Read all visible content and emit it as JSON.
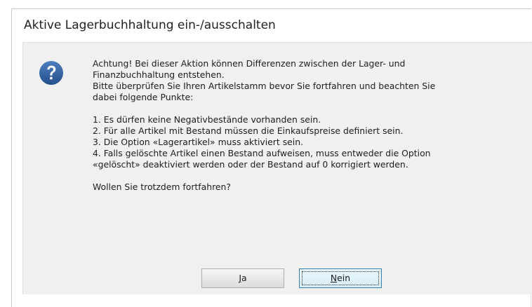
{
  "dialog": {
    "title": "Aktive Lagerbuchhaltung ein-/ausschalten",
    "icon": "question-mark-icon",
    "message": {
      "intro_line1": "Achtung! Bei dieser Aktion können Differenzen zwischen der Lager- und",
      "intro_line2": "Finanzbuchhaltung entstehen.",
      "intro_line3": "Bitte überprüfen Sie Ihren Artikelstamm bevor Sie fortfahren und beachten Sie",
      "intro_line4": "dabei folgende Punkte:",
      "points": {
        "p1": "1. Es dürfen keine Negativbestände vorhanden sein.",
        "p2": "2. Für alle Artikel mit Bestand müssen die Einkaufspreise definiert sein.",
        "p3": "3. Die Option «Lagerartikel» muss aktiviert sein.",
        "p4_line1": "4. Falls gelöschte Artikel einen Bestand aufweisen, muss entweder die Option",
        "p4_line2": "«gelöscht» deaktiviert werden oder der Bestand auf 0 korrigiert werden."
      },
      "question": "Wollen Sie trotzdem fortfahren?"
    },
    "buttons": {
      "yes": {
        "mnemonic": "J",
        "rest": "a"
      },
      "no": {
        "mnemonic": "N",
        "rest": "ein"
      }
    },
    "colors": {
      "icon_blue": "#2f5f9e",
      "panel_bg": "#f0f0f0",
      "focus_border": "#3c7fb1"
    }
  }
}
